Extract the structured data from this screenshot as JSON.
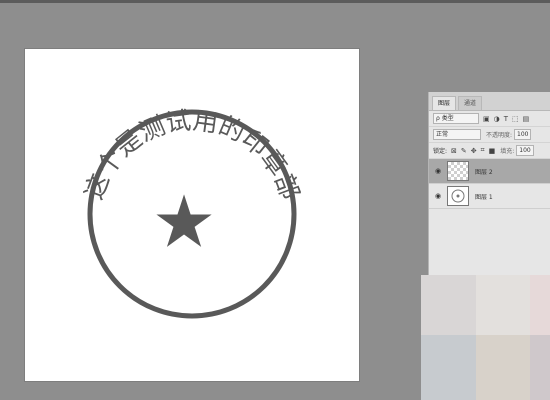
{
  "stamp": {
    "arc_text": "这个是测试用的印章部",
    "star": "★",
    "color": "#595959"
  },
  "panel": {
    "tabs": [
      "图层",
      "通道"
    ],
    "kind_label": "ρ 类型",
    "blend_mode": "正常",
    "opacity_label": "不透明度:",
    "opacity_value": "100",
    "lock_label": "锁定:",
    "fill_label": "填充:",
    "fill_value": "100",
    "layers": [
      {
        "name": "图层 2"
      },
      {
        "name": "图层 1"
      }
    ]
  },
  "colors": {
    "workspace": "#8e8e8e",
    "panel": "#e6e6e6",
    "selected_layer": "#a8a8a8"
  }
}
